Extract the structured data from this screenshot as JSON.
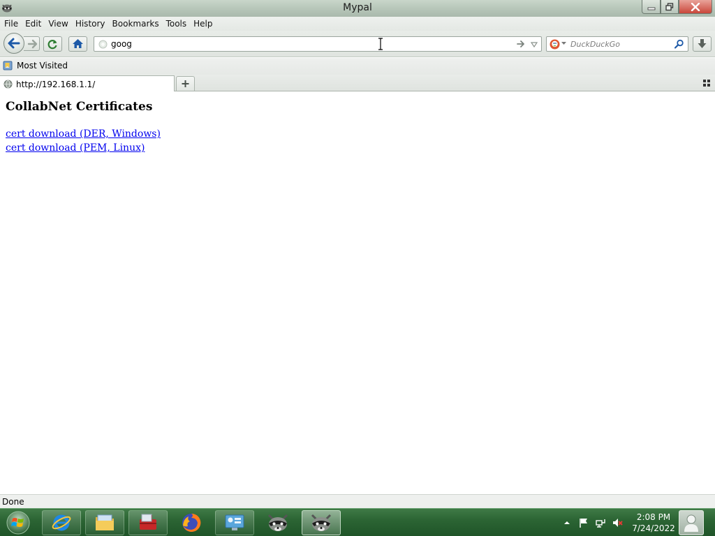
{
  "window": {
    "title": "Mypal",
    "app_icon": "raccoon-icon",
    "controls": {
      "minimize": "minimize-icon",
      "maximize": "restore-icon",
      "close": "close-icon"
    }
  },
  "menu": [
    "File",
    "Edit",
    "View",
    "History",
    "Bookmarks",
    "Tools",
    "Help"
  ],
  "navigation": {
    "url_value": "goog",
    "search_placeholder": "DuckDuckGo",
    "search_engine_icon": "duckduckgo-icon"
  },
  "bookmarks": {
    "items": [
      {
        "label": "Most Visited",
        "icon": "bookmark-folder-icon"
      }
    ]
  },
  "tabs": [
    {
      "title": "http://192.168.1.1/",
      "active": true
    }
  ],
  "page": {
    "heading": "CollabNet Certificates",
    "links": [
      "cert download (DER, Windows)",
      "cert download (PEM, Linux)"
    ]
  },
  "status": {
    "text": "Done"
  },
  "taskbar": {
    "apps": [
      "internet-explorer-icon",
      "file-explorer-icon",
      "toolbox-icon",
      "firefox-icon",
      "control-panel-icon",
      "raccoon-icon",
      "mypal-icon"
    ],
    "clock_time": "2:08 PM",
    "clock_date": "7/24/2022"
  },
  "colors": {
    "link": "#0000ee",
    "taskbar": "#2c6534",
    "close_button": "#c9473b"
  }
}
